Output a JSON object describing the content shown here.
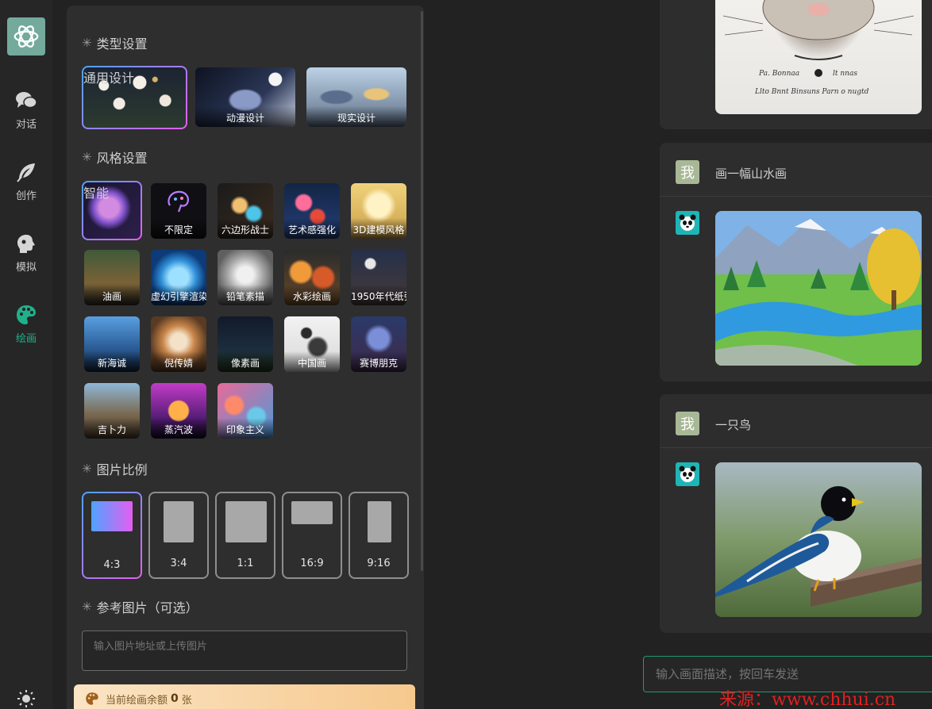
{
  "nav": {
    "items": [
      {
        "label": "对话",
        "icon": "chat-bubbles-icon"
      },
      {
        "label": "创作",
        "icon": "feather-icon"
      },
      {
        "label": "模拟",
        "icon": "head-icon"
      },
      {
        "label": "绘画",
        "icon": "palette-icon"
      }
    ],
    "active": "绘画",
    "accent": "#20b08a"
  },
  "sections": {
    "type_title": "类型设置",
    "style_title": "风格设置",
    "ratio_title": "图片比例",
    "ref_title": "参考图片（可选）"
  },
  "types": [
    {
      "label": "通用设计",
      "selected": true
    },
    {
      "label": "动漫设计",
      "selected": false
    },
    {
      "label": "现实设计",
      "selected": false
    }
  ],
  "styles": [
    {
      "label": "智能",
      "selected": true
    },
    {
      "label": "不限定"
    },
    {
      "label": "六边形战士"
    },
    {
      "label": "艺术感强化"
    },
    {
      "label": "3D建模风格"
    },
    {
      "label": "油画"
    },
    {
      "label": "虚幻引擎渲染"
    },
    {
      "label": "铅笔素描"
    },
    {
      "label": "水彩绘画"
    },
    {
      "label": "1950年代纸张"
    },
    {
      "label": "新海诚"
    },
    {
      "label": "倪传婧"
    },
    {
      "label": "像素画"
    },
    {
      "label": "中国画"
    },
    {
      "label": "赛博朋克"
    },
    {
      "label": "吉卜力"
    },
    {
      "label": "蒸汽波"
    },
    {
      "label": "印象主义"
    }
  ],
  "ratios": [
    {
      "label": "4:3",
      "selected": true
    },
    {
      "label": "3:4"
    },
    {
      "label": "1:1"
    },
    {
      "label": "16:9"
    },
    {
      "label": "9:16"
    }
  ],
  "ref_input": {
    "placeholder": "输入图片地址或上传图片"
  },
  "quota": {
    "prefix": "当前绘画余额",
    "count": "0",
    "unit": "张"
  },
  "chat": {
    "messages": [
      {
        "role": "user",
        "text": "画一幅山水画",
        "badge": "我"
      },
      {
        "role": "user",
        "text": "一只鸟",
        "badge": "我"
      }
    ]
  },
  "prompt": {
    "placeholder": "输入画面描述，按回车发送"
  },
  "watermark": "来源：www.chhui.cn"
}
